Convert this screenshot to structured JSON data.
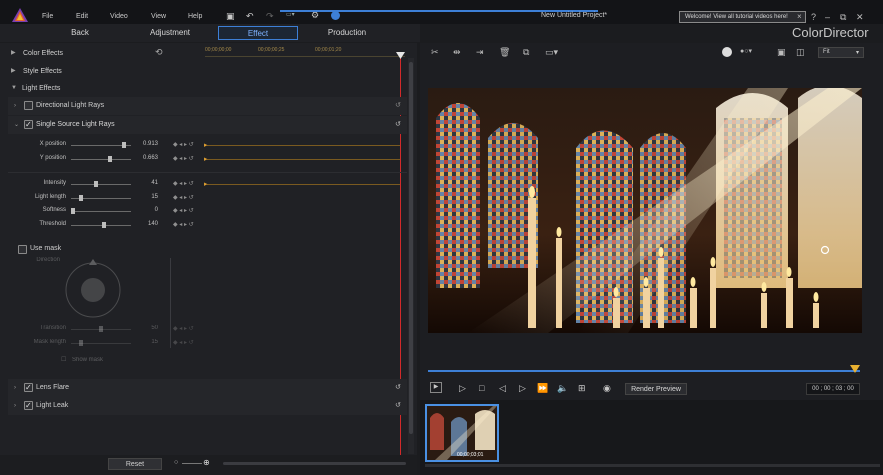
{
  "app": {
    "title": "New Untitled Project*",
    "brand": "ColorDirector",
    "notice": "Welcome! View all tutorial videos here!"
  },
  "menu": [
    "File",
    "Edit",
    "Video",
    "View",
    "Help"
  ],
  "modes": {
    "back": "Back",
    "adjustment": "Adjustment",
    "effect": "Effect",
    "production": "Production"
  },
  "timeline": {
    "t0": "00;00;00;00",
    "t1": "00;00;00;25",
    "t2": "00;00;01;20"
  },
  "sections": {
    "color_effects": "Color Effects",
    "style_effects": "Style Effects",
    "light_effects": "Light Effects",
    "directional_light_rays": "Directional Light Rays",
    "single_source_light_rays": "Single Source Light Rays",
    "use_mask": "Use mask",
    "lens_flare": "Lens Flare",
    "light_leak": "Light Leak"
  },
  "params": {
    "x_position": {
      "label": "X position",
      "value": "0.913",
      "level": 0.913
    },
    "y_position": {
      "label": "Y position",
      "value": "0.663",
      "level": 0.663
    },
    "intensity": {
      "label": "Intensity",
      "value": "41",
      "level": 0.41
    },
    "light_length": {
      "label": "Light length",
      "value": "15",
      "level": 0.15
    },
    "softness": {
      "label": "Softness",
      "value": "0",
      "level": 0.0
    },
    "threshold": {
      "label": "Threshold",
      "value": "140",
      "level": 0.55
    },
    "direction": {
      "label": "Direction"
    },
    "transition": {
      "label": "Transition",
      "value": "50",
      "level": 0.5
    },
    "mask_length": {
      "label": "Mask length",
      "value": "15",
      "level": 0.15
    },
    "show_mask": "Show mask"
  },
  "controls": {
    "reset": "Reset",
    "render_preview": "Render Preview",
    "timecode": "00 ; 00 ; 03 ; 00",
    "fit": "Fit",
    "thumb_time": "00;00;03;01"
  },
  "colors": {
    "accent": "#3d7fd6",
    "playhead": "#d22a2a",
    "keyframe": "#e0a030"
  }
}
